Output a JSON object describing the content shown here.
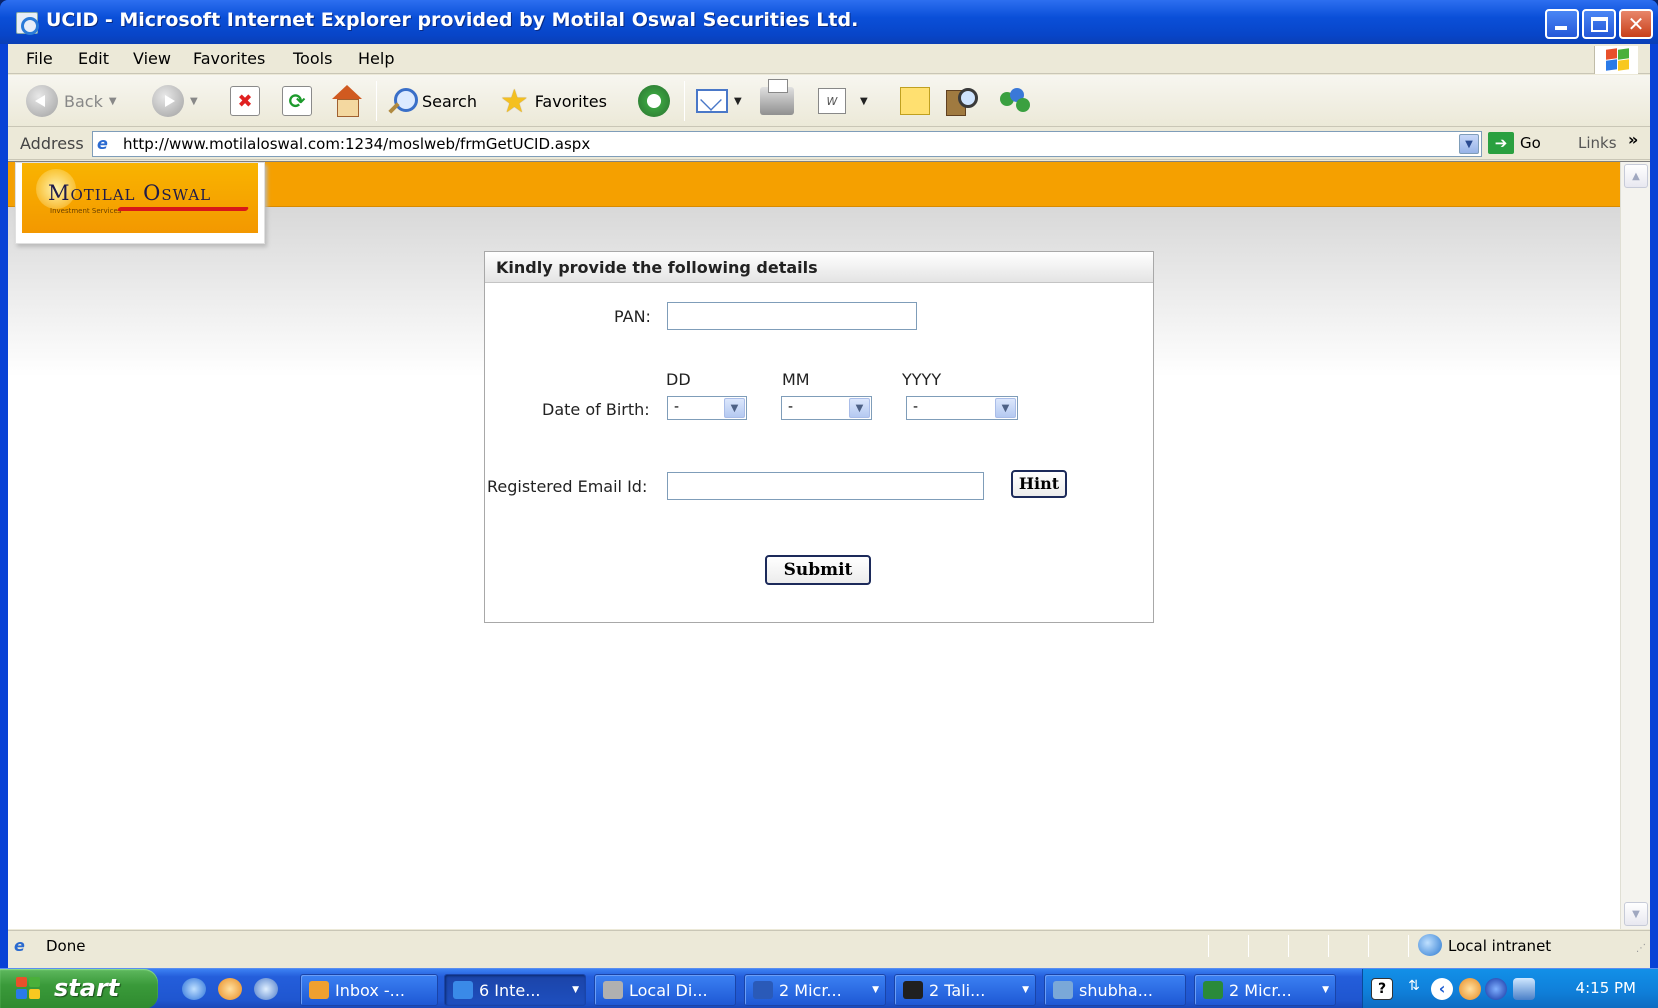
{
  "window": {
    "title": "UCID - Microsoft Internet Explorer provided by Motilal Oswal Securities Ltd."
  },
  "menu": [
    "File",
    "Edit",
    "View",
    "Favorites",
    "Tools",
    "Help"
  ],
  "toolbar": {
    "back_label": "Back",
    "search_label": "Search",
    "favorites_label": "Favorites",
    "edit_icon_text": "W"
  },
  "address": {
    "label": "Address",
    "url": "http://www.motilaloswal.com:1234/moslweb/frmGetUCID.aspx",
    "go_label": "Go",
    "links_label": "Links",
    "links_chevron": "»"
  },
  "page": {
    "logo_text": "Motilal Oswal",
    "logo_subtext": "Investment Services",
    "brand_colors": {
      "orange": "#f5a000",
      "logo_text": "#1e1b4b",
      "swoosh": "#d81818"
    },
    "form": {
      "title": "Kindly provide the following details",
      "pan_label": "PAN:",
      "pan_value": "",
      "dob_label": "Date of Birth:",
      "dd_header": "DD",
      "mm_header": "MM",
      "yyyy_header": "YYYY",
      "dd_value": "-",
      "mm_value": "-",
      "yyyy_value": "-",
      "email_label": "Registered Email Id:",
      "email_value": "",
      "hint_button": "Hint",
      "submit_button": "Submit"
    }
  },
  "status": {
    "text": "Done",
    "zone": "Local intranet"
  },
  "taskbar": {
    "start_label": "start",
    "tasks": [
      {
        "label": "Inbox -...",
        "icon_color": "#f0a030",
        "dropdown": false,
        "active": false
      },
      {
        "label": "6 Inte...",
        "icon_color": "#3a8ae8",
        "dropdown": true,
        "active": true
      },
      {
        "label": "Local Di...",
        "icon_color": "#b0b0b0",
        "dropdown": false,
        "active": false
      },
      {
        "label": "2 Micr...",
        "icon_color": "#2a5ab8",
        "dropdown": true,
        "active": false
      },
      {
        "label": "2 Tali...",
        "icon_color": "#202020",
        "dropdown": true,
        "active": false
      },
      {
        "label": "shubha...",
        "icon_color": "#7aa8d8",
        "dropdown": false,
        "active": false
      },
      {
        "label": "2 Micr...",
        "icon_color": "#2a8a3a",
        "dropdown": true,
        "active": false
      }
    ],
    "clock": "4:15 PM"
  }
}
